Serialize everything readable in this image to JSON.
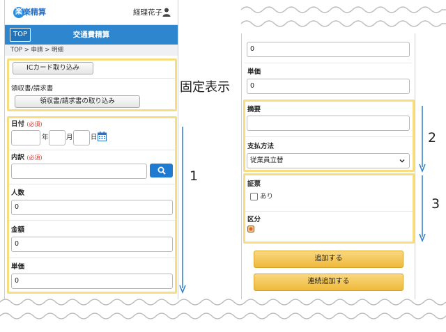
{
  "left": {
    "app_logo": "楽精算",
    "logo_mark": "楽",
    "user_name": "経理花子",
    "top_button": "TOP",
    "title": "交通費精算",
    "breadcrumb": "TOP > 申請 > 明細",
    "ic_button": "ICカード取り込み",
    "receipt_label": "領収書/請求書",
    "receipt_button": "領収書/請求書の取り込み",
    "date_label": "日付",
    "required": "(必須)",
    "date_year_unit": "年",
    "date_month_unit": "月",
    "date_day_unit": "日",
    "detail_label": "内訳",
    "people_label": "人数",
    "people_value": "0",
    "amount_label": "金額",
    "amount_value": "0",
    "unit_price_label": "単価",
    "unit_price_value": "0"
  },
  "right": {
    "top_input_value": "0",
    "unit_price_label": "単価",
    "unit_price_value": "0",
    "summary_label": "摘要",
    "summary_value": "",
    "payment_label": "支払方法",
    "payment_selected": "従業員立替",
    "voucher_label": "証票",
    "voucher_option": "あり",
    "category_label": "区分",
    "add_button": "追加する",
    "add_continue_button": "連続追加する"
  },
  "annotations": {
    "fixed_display": "固定表示",
    "label_1": "1",
    "label_2": "2",
    "label_3": "3"
  },
  "colors": {
    "accent_blue": "#2e86cf",
    "highlight_yellow": "#f6dd80",
    "button_yellow": "#efb93a",
    "required_red": "#e0352b",
    "arrow_blue": "#2a7cc7"
  },
  "icons": {
    "user": "user-icon",
    "calendar": "calendar-icon",
    "search": "search-icon",
    "select": "chevron-down-icon",
    "category": "category-icon"
  }
}
